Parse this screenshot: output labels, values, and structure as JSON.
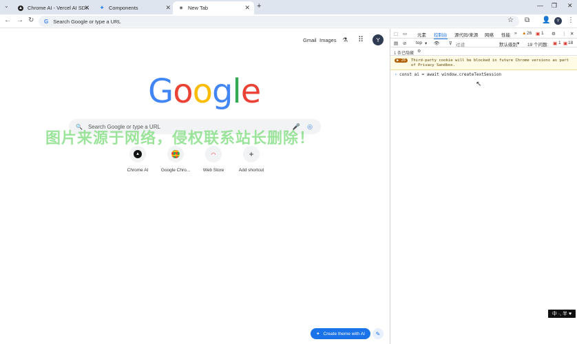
{
  "tabs": [
    {
      "label": "Chrome AI - Vercel AI SDK",
      "icon": "vercel-triangle-icon"
    },
    {
      "label": "Components",
      "icon": "puzzle-icon"
    },
    {
      "label": "New Tab",
      "icon": "chrome-icon"
    }
  ],
  "toolbar": {
    "omnibox_placeholder": "Search Google or type a URL"
  },
  "page": {
    "gmail": "Gmail",
    "images": "Images",
    "avatar": "Y",
    "logo": "Google",
    "search_placeholder": "Search Google or type a URL",
    "watermark": "图片来源于网络，侵权联系站长删除！",
    "shortcuts": [
      {
        "label": "Chrome AI",
        "icon": "vercel-triangle-icon"
      },
      {
        "label": "Google Chro...",
        "icon": "chrome-icon"
      },
      {
        "label": "Web Store",
        "icon": "web-store-icon"
      },
      {
        "label": "Add shortcut",
        "icon": "plus-icon"
      }
    ],
    "create_theme": "Create theme with AI"
  },
  "devtools": {
    "tabs": [
      "元素",
      "控制台",
      "源代码/来源",
      "网络",
      "性能"
    ],
    "warn_count": "26",
    "error_count": "1",
    "context": "top",
    "filter_placeholder": "过滤",
    "level": "默认级别",
    "issues": "19 个问题:",
    "issue_err": "1",
    "issue_warn": "18",
    "hidden": "1 条已隐藏",
    "warning_badge": "26",
    "warning_text": "Third-party cookie will be blocked in future Chrome versions as part of Privacy Sandbox.",
    "input_code": "const ai = await window.createTextSession"
  },
  "ime": "中 ·, 半 ♥"
}
